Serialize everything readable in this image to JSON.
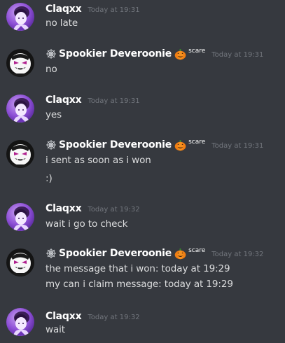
{
  "messages": [
    {
      "author": "Claqxx",
      "role": "claqxx",
      "timestamp": "Today at 19:31",
      "lines": [
        "no late"
      ]
    },
    {
      "author": "Spookier Deveroonie",
      "role": "spookier",
      "badge": "scare",
      "timestamp": "Today at 19:31",
      "lines": [
        "no"
      ]
    },
    {
      "author": "Claqxx",
      "role": "claqxx",
      "timestamp": "Today at 19:31",
      "lines": [
        "yes"
      ]
    },
    {
      "author": "Spookier Deveroonie",
      "role": "spookier",
      "badge": "scare",
      "timestamp": "Today at 19:31",
      "lines": [
        "i sent as soon as i won",
        ":)"
      ]
    },
    {
      "author": "Claqxx",
      "role": "claqxx",
      "timestamp": "Today at 19:32",
      "lines": [
        "wait i go to check"
      ]
    },
    {
      "author": "Spookier Deveroonie",
      "role": "spookier",
      "badge": "scare",
      "timestamp": "Today at 19:32",
      "lines": [
        "the message that i won: today at 19:29",
        "my can i claim message: today at 19:29"
      ]
    },
    {
      "author": "Claqxx",
      "role": "claqxx",
      "timestamp": "Today at 19:32",
      "lines": [
        "wait"
      ]
    }
  ],
  "icons": {
    "web": "spider-web-icon",
    "pumpkin": "pumpkin-icon"
  },
  "colors": {
    "background": "#36393f",
    "text": "#dcddde",
    "username": "#ffffff",
    "timestamp": "#72767d"
  }
}
